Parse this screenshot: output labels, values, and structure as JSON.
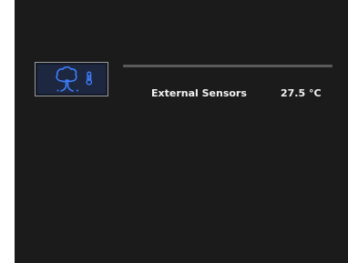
{
  "external_sensors": {
    "label": "External Sensors",
    "value": "27.5 °C",
    "icons": [
      "tree-icon",
      "thermometer-icon"
    ]
  },
  "colors": {
    "screen_background": "#1b1b1b",
    "tile_background": "#1d2740",
    "icon_accent": "#3f7fff",
    "divider": "#5a5a5a",
    "text": "#f2f2f2"
  }
}
